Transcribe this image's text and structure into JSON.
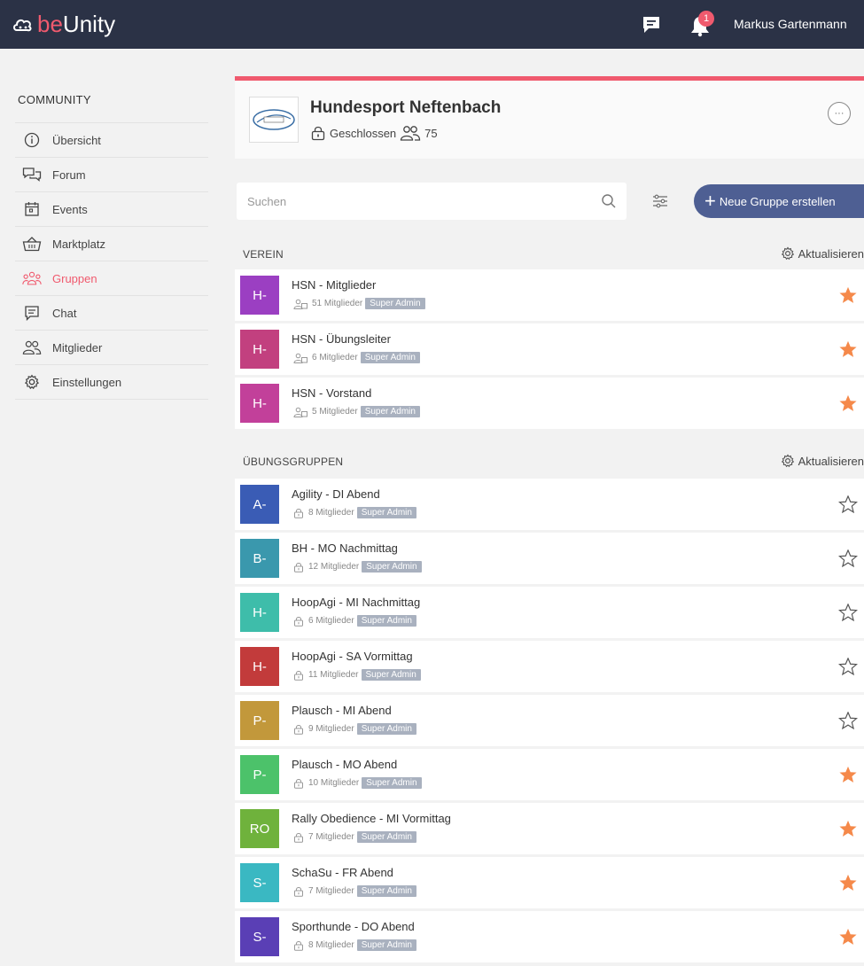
{
  "app": {
    "logo_prefix": "be",
    "logo_suffix": "Unity",
    "notification_count": "1",
    "user_name": "Markus Gartenmann"
  },
  "sidebar": {
    "title": "COMMUNITY",
    "items": [
      {
        "label": "Übersicht",
        "icon": "info-icon",
        "active": false
      },
      {
        "label": "Forum",
        "icon": "chat-bubbles-icon",
        "active": false
      },
      {
        "label": "Events",
        "icon": "calendar-icon",
        "active": false
      },
      {
        "label": "Marktplatz",
        "icon": "basket-icon",
        "active": false
      },
      {
        "label": "Gruppen",
        "icon": "groups-icon",
        "active": true
      },
      {
        "label": "Chat",
        "icon": "message-icon",
        "active": false
      },
      {
        "label": "Mitglieder",
        "icon": "members-icon",
        "active": false
      },
      {
        "label": "Einstellungen",
        "icon": "gear-icon",
        "active": false
      }
    ]
  },
  "club": {
    "name": "Hundesport Neftenbach",
    "status": "Geschlossen",
    "member_count": "75",
    "more_label": "···"
  },
  "toolbar": {
    "search_placeholder": "Suchen",
    "new_group_label": "Neue Gruppe erstellen"
  },
  "sections": [
    {
      "title": "VEREIN",
      "refresh_label": "Aktualisieren",
      "groups": [
        {
          "initials": "H-",
          "color": "#9b3fc2",
          "name": "HSN - Mitglieder",
          "members": "51 Mitglieder",
          "role": "Super Admin",
          "favorite": true,
          "icon": "members-small-icon"
        },
        {
          "initials": "H-",
          "color": "#c2407f",
          "name": "HSN - Übungsleiter",
          "members": "6 Mitglieder",
          "role": "Super Admin",
          "favorite": true,
          "icon": "members-small-icon"
        },
        {
          "initials": "H-",
          "color": "#c2409a",
          "name": "HSN - Vorstand",
          "members": "5 Mitglieder",
          "role": "Super Admin",
          "favorite": true,
          "icon": "members-small-icon"
        }
      ]
    },
    {
      "title": "ÜBUNGSGRUPPEN",
      "refresh_label": "Aktualisieren",
      "groups": [
        {
          "initials": "A-",
          "color": "#3a5cb5",
          "name": "Agility - DI Abend",
          "members": "8 Mitglieder",
          "role": "Super Admin",
          "favorite": false,
          "icon": "lock-icon"
        },
        {
          "initials": "B-",
          "color": "#3a98ad",
          "name": "BH - MO Nachmittag",
          "members": "12 Mitglieder",
          "role": "Super Admin",
          "favorite": false,
          "icon": "lock-icon"
        },
        {
          "initials": "H-",
          "color": "#3ebdaa",
          "name": "HoopAgi - MI Nachmittag",
          "members": "6 Mitglieder",
          "role": "Super Admin",
          "favorite": false,
          "icon": "lock-icon"
        },
        {
          "initials": "H-",
          "color": "#c23b3b",
          "name": "HoopAgi - SA Vormittag",
          "members": "11 Mitglieder",
          "role": "Super Admin",
          "favorite": false,
          "icon": "lock-icon"
        },
        {
          "initials": "P-",
          "color": "#c2983b",
          "name": "Plausch - MI Abend",
          "members": "9 Mitglieder",
          "role": "Super Admin",
          "favorite": false,
          "icon": "lock-icon"
        },
        {
          "initials": "P-",
          "color": "#4cc26a",
          "name": "Plausch - MO Abend",
          "members": "10 Mitglieder",
          "role": "Super Admin",
          "favorite": true,
          "icon": "lock-icon"
        },
        {
          "initials": "RO",
          "color": "#6fb23c",
          "name": "Rally Obedience - MI Vormittag",
          "members": "7 Mitglieder",
          "role": "Super Admin",
          "favorite": true,
          "icon": "lock-icon"
        },
        {
          "initials": "S-",
          "color": "#3ab8c2",
          "name": "SchaSu - FR Abend",
          "members": "7 Mitglieder",
          "role": "Super Admin",
          "favorite": true,
          "icon": "lock-icon"
        },
        {
          "initials": "S-",
          "color": "#5a3fb5",
          "name": "Sporthunde - DO Abend",
          "members": "8 Mitglieder",
          "role": "Super Admin",
          "favorite": true,
          "icon": "lock-icon"
        }
      ]
    }
  ],
  "colors": {
    "accent": "#f05a6e",
    "topbar": "#2b3246",
    "primary_button": "#4e5f93",
    "star_active": "#f5894a"
  }
}
